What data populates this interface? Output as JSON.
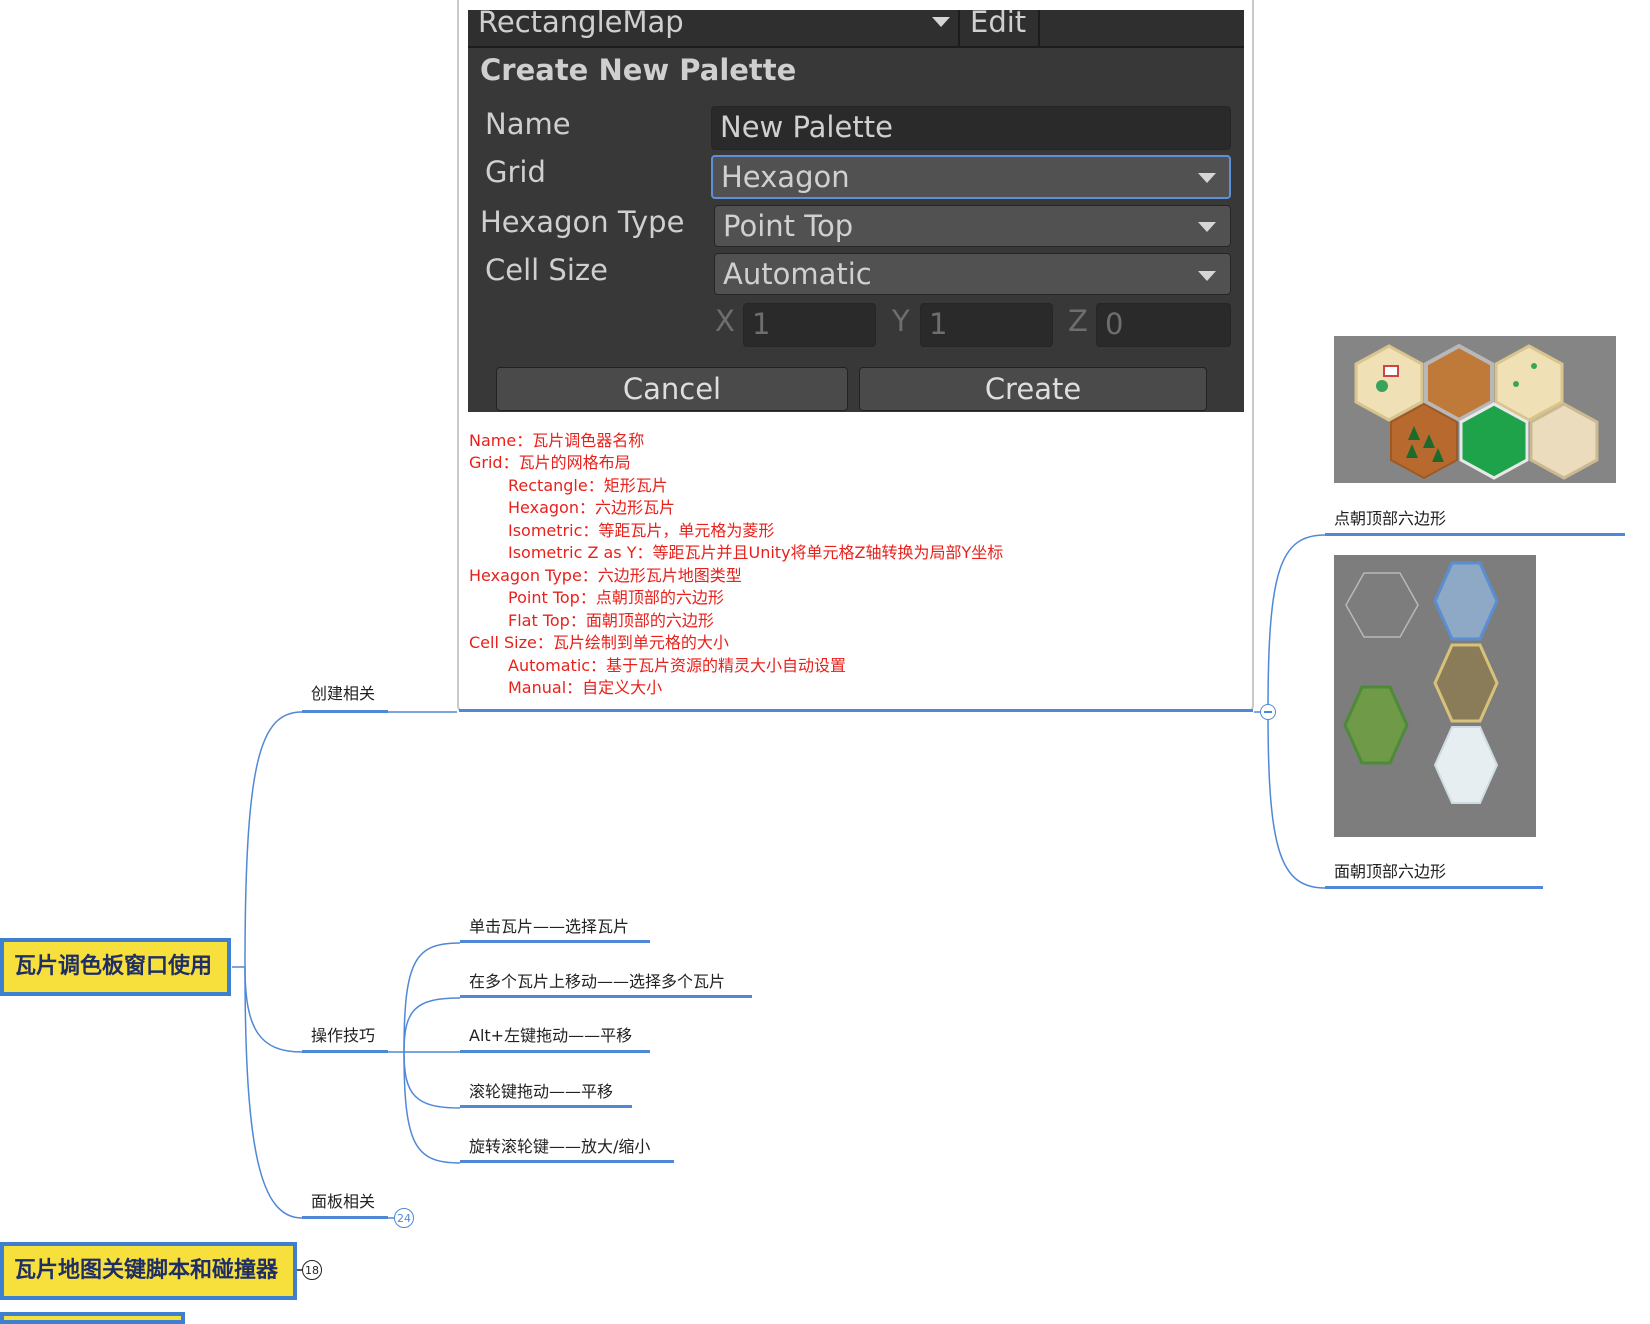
{
  "roots": [
    {
      "label": "瓦片调色板窗口使用"
    },
    {
      "label": "瓦片地图关键脚本和碰撞器",
      "badge": "18"
    }
  ],
  "branches": {
    "create": "创建相关",
    "ops": "操作技巧",
    "panel": {
      "label": "面板相关",
      "badge": "24"
    }
  },
  "ops_items": [
    "单击瓦片——选择瓦片",
    "在多个瓦片上移动——选择多个瓦片",
    "Alt+左键拖动——平移",
    "滚轮键拖动——平移",
    "旋转滚轮键——放大/缩小"
  ],
  "unity_dialog": {
    "map_dropdown": "RectangleMap",
    "edit_label": "Edit",
    "heading": "Create New Palette",
    "name_label": "Name",
    "name_value": "New Palette",
    "grid_label": "Grid",
    "grid_value": "Hexagon",
    "hex_type_label": "Hexagon Type",
    "hex_type_value": "Point Top",
    "cell_size_label": "Cell Size",
    "cell_size_value": "Automatic",
    "x_label": "X",
    "x_value": "1",
    "y_label": "Y",
    "y_value": "1",
    "z_label": "Z",
    "z_value": "0",
    "cancel": "Cancel",
    "create": "Create"
  },
  "notes": [
    "Name：瓦片调色器名称",
    "Grid：瓦片的网格布局",
    "Rectangle：矩形瓦片",
    "Hexagon：六边形瓦片",
    "Isometric：等距瓦片，单元格为菱形",
    "Isometric Z as Y：等距瓦片并且Unity将单元格Z轴转换为局部Y坐标",
    "Hexagon Type：六边形瓦片地图类型",
    "Point Top：点朝顶部的六边形",
    "Flat Top：面朝顶部的六边形",
    "Cell Size：瓦片绘制到单元格的大小",
    "Automatic：基于瓦片资源的精灵大小自动设置",
    "Manual：自定义大小"
  ],
  "hex_examples": [
    {
      "caption": "点朝顶部六边形"
    },
    {
      "caption": "面朝顶部六边形"
    }
  ],
  "colors": {
    "line": "#4f88d6",
    "root_fill": "#f7e03c",
    "root_border": "#3f7fd0",
    "note_text": "#e8211b",
    "unity_bg": "#383838"
  }
}
